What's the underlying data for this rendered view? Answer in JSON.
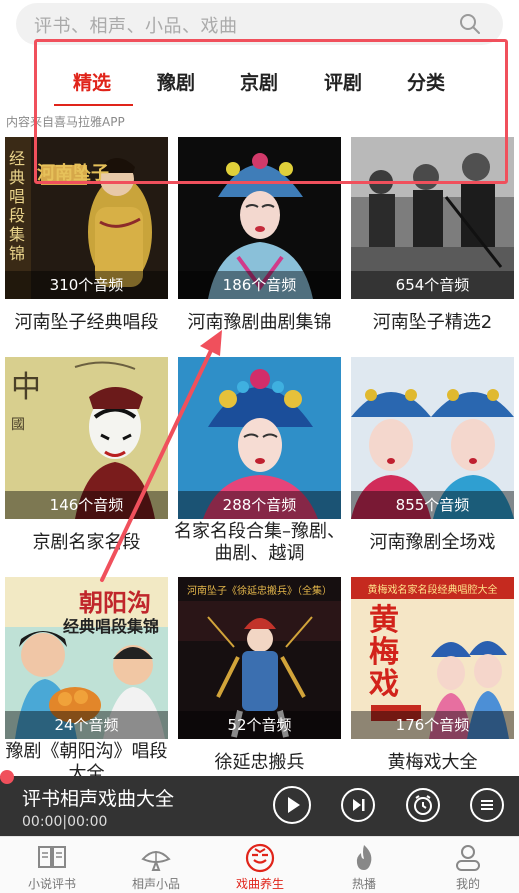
{
  "search": {
    "placeholder": "评书、相声、小品、戏曲"
  },
  "tabs": [
    {
      "label": "精选"
    },
    {
      "label": "豫剧"
    },
    {
      "label": "京剧"
    },
    {
      "label": "评剧"
    },
    {
      "label": "分类"
    }
  ],
  "source_note": "内容来自喜马拉雅APP",
  "albums": [
    {
      "title": "河南坠子经典唱段",
      "count": "310个音频",
      "cover_text": "经典唱段集锦",
      "cover_tag": "河南坠子"
    },
    {
      "title": "河南豫剧曲剧集锦",
      "count": "186个音频"
    },
    {
      "title": "河南坠子精选2",
      "count": "654个音频"
    },
    {
      "title": "京剧名家名段",
      "count": "146个音频"
    },
    {
      "title": "名家名段合集–豫剧、曲剧、越调",
      "count": "288个音频"
    },
    {
      "title": "河南豫剧全场戏",
      "count": "855个音频"
    },
    {
      "title": "豫剧《朝阳沟》唱段大全",
      "count": "24个音频",
      "cover_text": "朝阳沟",
      "cover_sub": "经典唱段集锦"
    },
    {
      "title": "徐延忠搬兵",
      "count": "52个音频",
      "cover_text": "河南坠子《徐延忠搬兵》（全集）"
    },
    {
      "title": "黄梅戏大全",
      "count": "176个音频",
      "cover_text": "黄梅戏",
      "cover_sub": "黄梅戏名家名段经典唱腔大全"
    }
  ],
  "player": {
    "title": "评书相声戏曲大全",
    "time": "00:00|00:00"
  },
  "nav": [
    {
      "label": "小说评书",
      "icon": "book-icon"
    },
    {
      "label": "相声小品",
      "icon": "fan-icon"
    },
    {
      "label": "戏曲养生",
      "icon": "opera-mask-icon",
      "active": true
    },
    {
      "label": "热播",
      "icon": "flame-icon"
    },
    {
      "label": "我的",
      "icon": "person-icon"
    }
  ],
  "colors": {
    "accent": "#e0241a",
    "highlight": "#f0505c",
    "player_bg": "#333333"
  }
}
